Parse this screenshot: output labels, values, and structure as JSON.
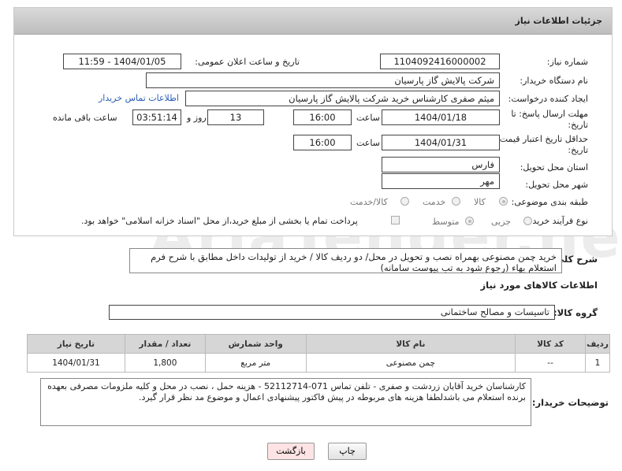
{
  "panel": {
    "title": "جزئیات اطلاعات نیاز"
  },
  "fields": {
    "need_number": {
      "label": "شماره نیاز:",
      "value": "1104092416000002"
    },
    "announce": {
      "label": "تاریخ و ساعت اعلان عمومی:",
      "value": "1404/01/05 - 11:59"
    },
    "buyer_org": {
      "label": "نام دستگاه خریدار:",
      "value": "شرکت پالایش گاز پارسیان"
    },
    "creator": {
      "label": "ایجاد کننده درخواست:",
      "value": "میثم صفری کارشناس خرید شرکت پالایش گاز پارسیان",
      "link": "اطلاعات تماس خریدار"
    },
    "deadline": {
      "label_line1": "مهلت ارسال پاسخ: تا",
      "label_line2": "تاریخ:",
      "date": "1404/01/18",
      "time_label": "ساعت",
      "time": "16:00",
      "days": "13",
      "days_label": "روز و",
      "remaining": "03:51:14",
      "remaining_label": "ساعت باقی مانده"
    },
    "validity": {
      "label_line1": "حداقل تاریخ اعتبار قیمت: تا",
      "label_line2": "تاریخ:",
      "date": "1404/01/31",
      "time_label": "ساعت",
      "time": "16:00"
    },
    "province": {
      "label": "استان محل تحویل:",
      "value": "فارس"
    },
    "city": {
      "label": "شهر محل تحویل:",
      "value": "مهر"
    },
    "category": {
      "label": "طبقه بندی موضوعی:",
      "options": [
        "کالا",
        "خدمت",
        "کالا/خدمت"
      ]
    },
    "process": {
      "label": "نوع فرآیند خرید :",
      "options": [
        "جزیی",
        "متوسط"
      ],
      "note": "پرداخت تمام یا بخشی از مبلغ خرید،از محل \"اسناد خزانه اسلامی\" خواهد بود."
    }
  },
  "summary": {
    "label": "شرح کلی نیاز:",
    "text": "خرید چمن مصنوعی بهمراه نصب و تحویل در محل/ دو ردیف کالا / خرید از تولیدات داخل مطابق با شرح فرم استعلام بهاء (رجوع شود به تب پیوست سامانه)"
  },
  "goods_info": {
    "title": "اطلاعات کالاهای مورد نیاز",
    "group_label": "گروه کالا:",
    "group_value": "تاسیسات و مصالح ساختمانی"
  },
  "table": {
    "headers": [
      "ردیف",
      "کد کالا",
      "نام کالا",
      "واحد شمارش",
      "تعداد / مقدار",
      "تاریخ نیاز"
    ],
    "rows": [
      [
        "1",
        "--",
        "چمن مصنوعی",
        "متر مربع",
        "1,800",
        "1404/01/31"
      ]
    ]
  },
  "buyer_notes": {
    "label": "توضیحات خریدار:",
    "text": "کارشناسان خرید آقایان زردشت و صفری - تلفن تماس 071-52112714 - هزینه حمل ، نصب در محل و کلیه ملزومات مصرفی بعهده برنده استعلام می باشدلطفا هزینه های مربوطه در پیش فاکتور پیشنهادی اعمال و موضوع مد نظر قرار گیرد."
  },
  "buttons": {
    "print": "چاپ",
    "back": "بازگشت"
  },
  "watermark": "AriaTender.neT",
  "colors": {
    "link": "#2b5db7",
    "back_button_bg": "#fde3e3",
    "header_bg": "#c9c9c9"
  }
}
